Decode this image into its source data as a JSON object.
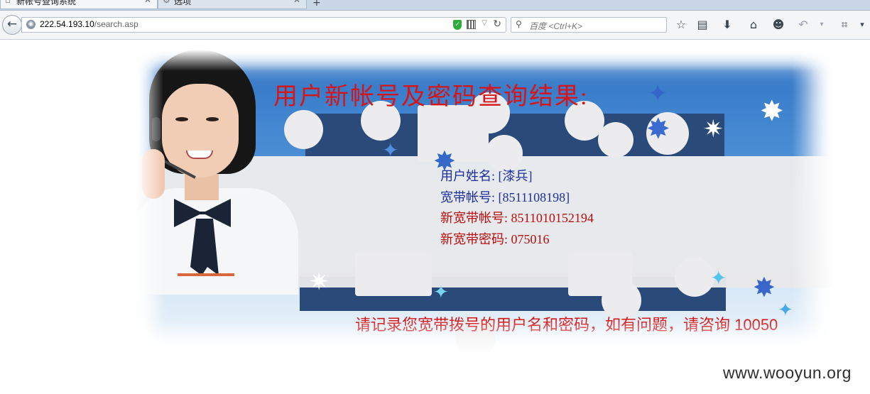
{
  "browser": {
    "tabs": [
      {
        "label": "新帐号查询系统",
        "active": true
      },
      {
        "label": "选项",
        "active": false
      }
    ],
    "new_tab_icon": "+",
    "url": {
      "host": "222.54.193.10",
      "path": "/search.asp"
    },
    "search_placeholder": "百度 <Ctrl+K>",
    "toolbar_icons": [
      "star-icon",
      "reading-list-icon",
      "download-icon",
      "home-icon",
      "chat-icon",
      "undo-icon",
      "crop-icon",
      "menu-icon"
    ]
  },
  "page": {
    "headline": "用户新帐号及密码查询结果:",
    "fields": [
      {
        "label": "用户姓名:",
        "value": "[漆兵]",
        "color": "#1c2f9a"
      },
      {
        "label": "宽带帐号:",
        "value": "[8511108198]",
        "color": "#1c2f9a"
      },
      {
        "label": "新宽带帐号:",
        "value": "8511010152194",
        "color": "#b90c0c"
      },
      {
        "label": "新宽带密码:",
        "value": "075016",
        "color": "#b90c0c"
      }
    ],
    "notice": "请记录您宽带拨号的用户名和密码，如有问题，请咨询 10050",
    "accent_color": "#d61518"
  },
  "watermark": "www.wooyun.org"
}
